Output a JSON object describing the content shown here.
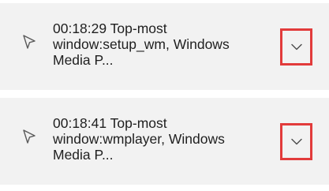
{
  "events": [
    {
      "text": "00:18:29 Top-most window:setup_wm, Windows Media P...",
      "icon": "cursor-pointer-icon",
      "action": "expand-chevron-down"
    },
    {
      "text": "00:18:41 Top-most window:wmplayer, Windows Media P...",
      "icon": "cursor-pointer-icon",
      "action": "expand-chevron-down"
    }
  ],
  "colors": {
    "card_background": "#f2f2f2",
    "highlight_border": "#e23b3b",
    "text": "#1f1f1f"
  }
}
